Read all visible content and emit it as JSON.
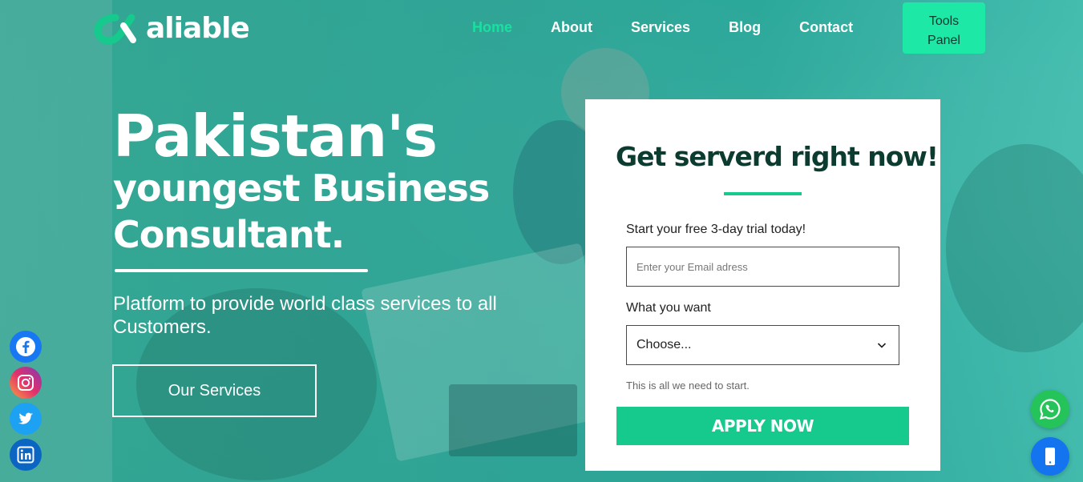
{
  "brand": {
    "name": "aliable",
    "accent": "#16c98d",
    "nav_active_color": "#19e0a0"
  },
  "nav": {
    "items": [
      {
        "label": "Home",
        "active": true
      },
      {
        "label": "About",
        "active": false
      },
      {
        "label": "Services",
        "active": false
      },
      {
        "label": "Blog",
        "active": false
      },
      {
        "label": "Contact",
        "active": false
      }
    ],
    "tools_button_line1": "Tools",
    "tools_button_line2": "Panel"
  },
  "hero": {
    "headline_line1": "Pakistan's",
    "headline_line2": "youngest Business",
    "headline_line3": "Consultant.",
    "subtitle": "Platform to provide world class services to all Customers.",
    "cta_label": "Our Services"
  },
  "social": [
    {
      "name": "facebook-icon",
      "glyph": "f"
    },
    {
      "name": "instagram-icon",
      "glyph": ""
    },
    {
      "name": "twitter-icon",
      "glyph": ""
    },
    {
      "name": "linkedin-icon",
      "glyph": "in"
    }
  ],
  "form": {
    "title": "Get serverd right now!",
    "trial_label": "Start your free 3-day trial today!",
    "email_placeholder": "Enter your Email adress",
    "want_label": "What you want",
    "select_value": "Choose...",
    "hint": "This is all we need to start.",
    "submit_label": "APPLY NOW"
  },
  "floating": {
    "whatsapp_icon": "whatsapp-icon",
    "phone_icon": "phone-icon"
  }
}
